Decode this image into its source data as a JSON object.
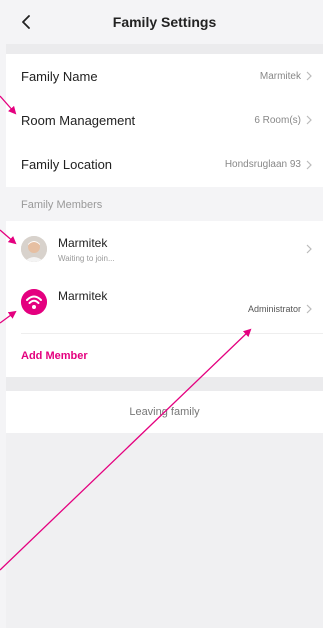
{
  "header": {
    "title": "Family Settings"
  },
  "settings": {
    "family_name_label": "Family Name",
    "family_name_value": "Marmitek",
    "room_label": "Room Management",
    "room_value": "6 Room(s)",
    "location_label": "Family Location",
    "location_value": "Hondsruglaan 93"
  },
  "members_section": {
    "title": "Family Members",
    "members": [
      {
        "name": "Marmitek",
        "subtitle": "Waiting to join...",
        "role": ""
      },
      {
        "name": "Marmitek",
        "subtitle": "",
        "role": "Administrator"
      }
    ],
    "add_label": "Add Member"
  },
  "leave_label": "Leaving family",
  "colors": {
    "accent": "#e4007f",
    "background": "#f4f4f6",
    "card": "#ffffff"
  },
  "icons": {
    "back": "chevron-left-icon",
    "row_arrow": "chevron-right-icon",
    "member_photo": "person-photo-avatar",
    "member_logo": "marmitek-wifi-logo"
  }
}
